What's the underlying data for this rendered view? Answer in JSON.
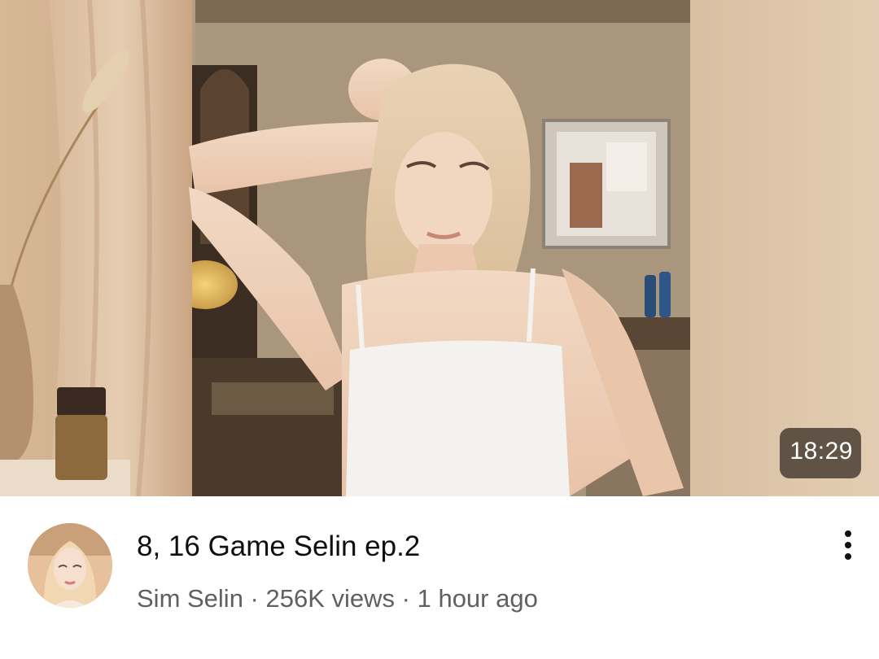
{
  "video": {
    "duration": "18:29",
    "title": "8, 16 Game Selin ep.2",
    "channel": "Sim Selin",
    "separator": " · ",
    "views": "256K views",
    "published": "1 hour ago"
  },
  "icons": {
    "more": "vertical-ellipsis-icon"
  }
}
